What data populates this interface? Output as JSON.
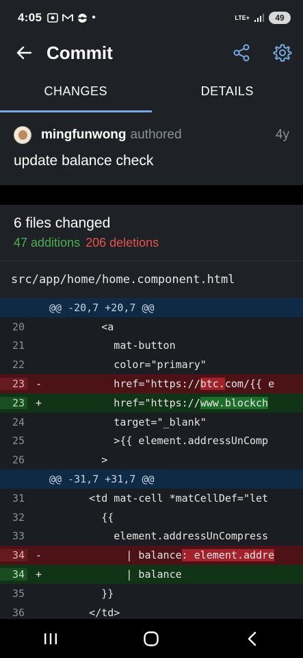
{
  "status_bar": {
    "time": "4:05",
    "network": "LTE+",
    "battery": "49"
  },
  "app_bar": {
    "title": "Commit"
  },
  "tabs": [
    {
      "label": "CHANGES",
      "active": true
    },
    {
      "label": "DETAILS",
      "active": false
    }
  ],
  "commit": {
    "author": "mingfunwong",
    "authored_label": "authored",
    "age": "4y",
    "message": "update balance check"
  },
  "summary": {
    "files_changed": "6 files changed",
    "additions": "47 additions",
    "deletions": "206 deletions"
  },
  "file": {
    "path": "src/app/home/home.component.html"
  },
  "diff_lines": [
    {
      "type": "hunk",
      "num": "",
      "marker": "",
      "code": "@@ -20,7 +20,7 @@"
    },
    {
      "type": "ctx",
      "num": "20",
      "marker": "",
      "code": "        <a"
    },
    {
      "type": "ctx",
      "num": "21",
      "marker": "",
      "code": "          mat-button"
    },
    {
      "type": "ctx",
      "num": "22",
      "marker": "",
      "code": "          color=\"primary\""
    },
    {
      "type": "del",
      "num": "23",
      "marker": "-",
      "code_pre": "          href=\"https://",
      "code_hl": "btc.",
      "code_post": "com/{{ e"
    },
    {
      "type": "add",
      "num": "23",
      "marker": "+",
      "code_pre": "          href=\"https://",
      "code_hl": "www.blockch",
      "code_post": ""
    },
    {
      "type": "ctx",
      "num": "24",
      "marker": "",
      "code": "          target=\"_blank\""
    },
    {
      "type": "ctx",
      "num": "25",
      "marker": "",
      "code": "          >{{ element.addressUnComp"
    },
    {
      "type": "ctx",
      "num": "26",
      "marker": "",
      "code": "        >"
    },
    {
      "type": "hunk",
      "num": "",
      "marker": "",
      "code": "@@ -31,7 +31,7 @@"
    },
    {
      "type": "ctx",
      "num": "31",
      "marker": "",
      "code": "      <td mat-cell *matCellDef=\"let"
    },
    {
      "type": "ctx",
      "num": "32",
      "marker": "",
      "code": "        {{"
    },
    {
      "type": "ctx",
      "num": "33",
      "marker": "",
      "code": "          element.addressUnCompress"
    },
    {
      "type": "del",
      "num": "34",
      "marker": "-",
      "code_pre": "            | balance",
      "code_hl": ": element.addre",
      "code_post": ""
    },
    {
      "type": "add",
      "num": "34",
      "marker": "+",
      "code_pre": "            | balance",
      "code_hl": "",
      "code_post": ""
    },
    {
      "type": "ctx",
      "num": "35",
      "marker": "",
      "code": "        }}"
    },
    {
      "type": "ctx",
      "num": "36",
      "marker": "",
      "code": "      </td>"
    }
  ],
  "icons": {
    "back": "arrow-back-icon",
    "share": "share-icon",
    "settings": "gear-icon"
  },
  "colors": {
    "accent": "#7aa9e0",
    "additions": "#4caf50",
    "deletions": "#e5534b"
  }
}
